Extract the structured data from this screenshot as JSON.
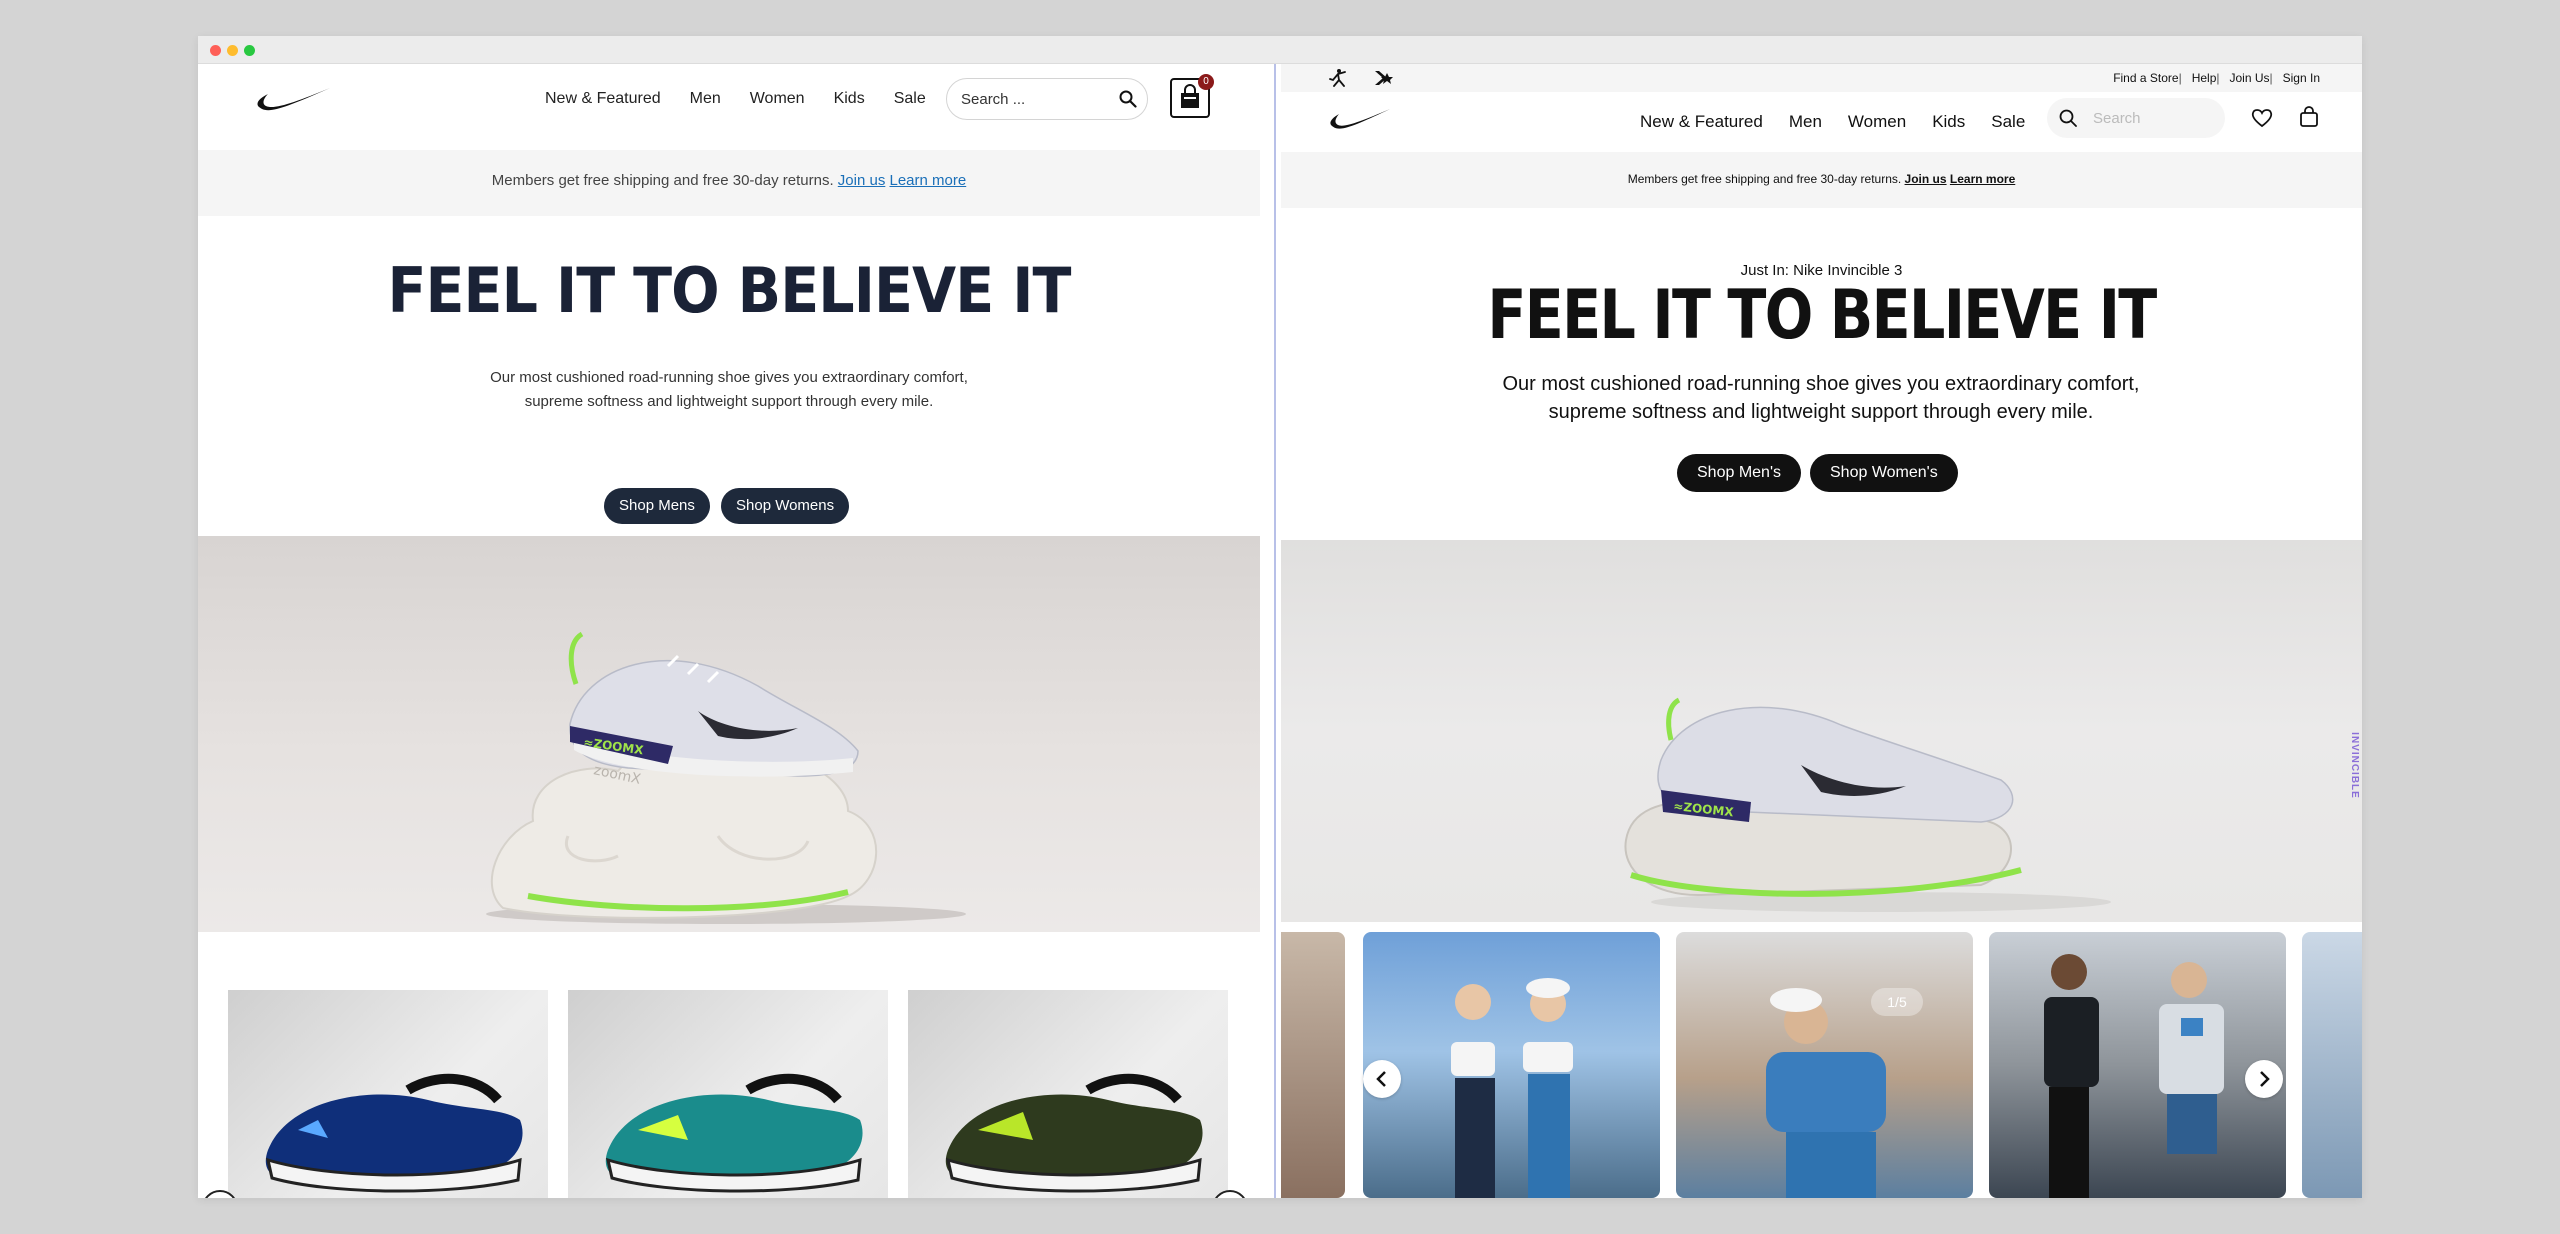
{
  "left": {
    "nav": {
      "links": [
        "New & Featured",
        "Men",
        "Women",
        "Kids",
        "Sale"
      ],
      "search_placeholder": "Search ...",
      "cart_count": "0"
    },
    "banner": {
      "text": "Members get free shipping and free 30-day returns.",
      "join_label": "Join us",
      "learn_label": "Learn more"
    },
    "hero": {
      "title": "FEEL IT TO BELIEVE IT",
      "subtitle_line1": "Our most cushioned road-running shoe gives you extraordinary comfort,",
      "subtitle_line2": "supreme softness and lightweight support through every mile.",
      "shop_mens": "Shop Mens",
      "shop_womens": "Shop Womens"
    },
    "colors": {
      "title": "#1a2236",
      "button": "#1e293b",
      "link": "#1a6fb8",
      "badge": "#8b1a1a"
    }
  },
  "right": {
    "utility": {
      "links": [
        "Find a Store",
        "Help",
        "Join Us",
        "Sign In"
      ]
    },
    "nav": {
      "links": [
        "New & Featured",
        "Men",
        "Women",
        "Kids",
        "Sale"
      ],
      "search_placeholder": "Search"
    },
    "banner": {
      "text": "Members get free shipping and free 30-day returns.",
      "join_label": "Join us",
      "learn_label": "Learn more"
    },
    "hero": {
      "eyebrow": "Just In: Nike Invincible 3",
      "title": "FEEL IT TO BELIEVE IT",
      "subtitle_line1": "Our most cushioned road-running shoe gives you extraordinary comfort,",
      "subtitle_line2": "supreme softness and lightweight support through every mile.",
      "shop_mens": "Shop Men's",
      "shop_womens": "Shop Women's",
      "side_label": "INVINCIBLE"
    },
    "gallery": {
      "counter": "1/5"
    },
    "colors": {
      "title": "#111111",
      "button": "#111111",
      "side_label": "#8b6fd8"
    }
  },
  "icons": {
    "left_logo": "nike-swoosh-icon",
    "search": "search-icon",
    "cart": "shopping-bag-icon",
    "jordan": "jordan-jumpman-icon",
    "converse": "converse-star-icon",
    "heart": "heart-icon",
    "prev": "chevron-left-icon",
    "next": "chevron-right-icon"
  }
}
